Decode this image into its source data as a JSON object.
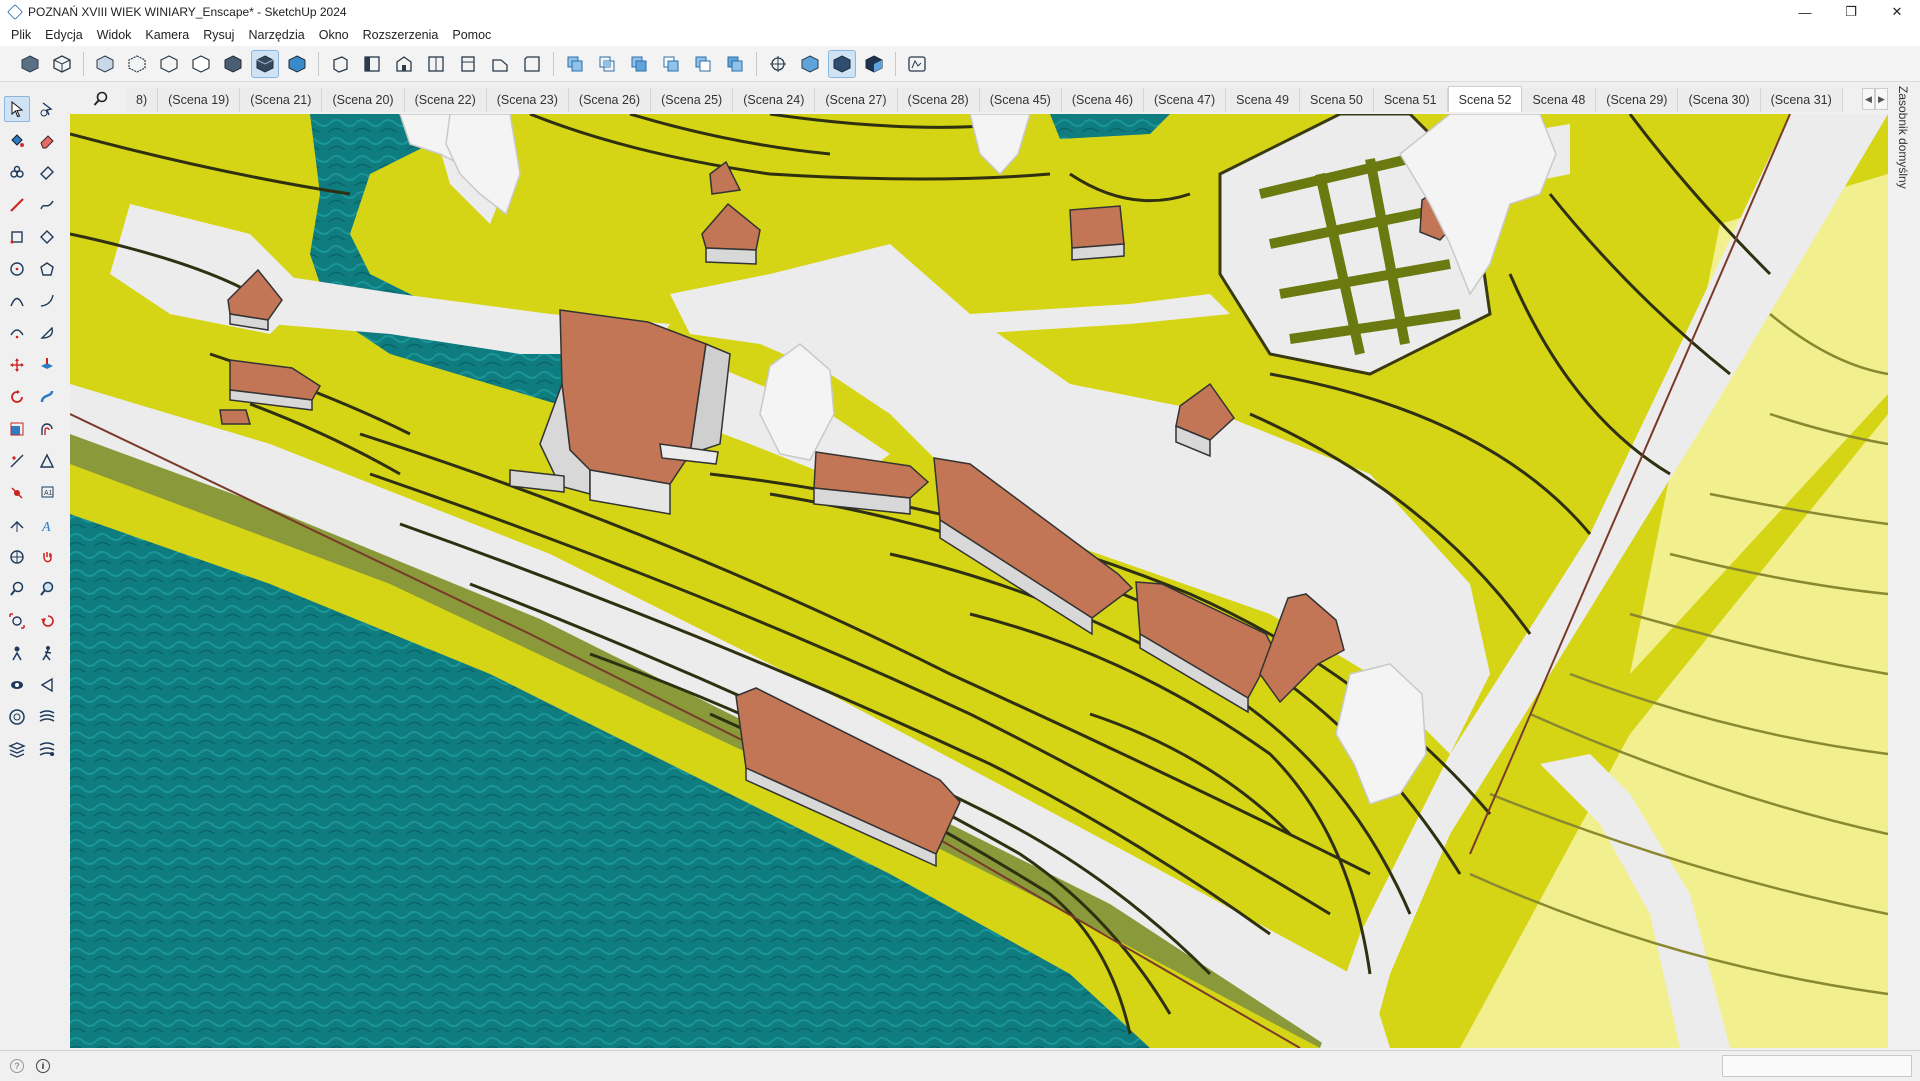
{
  "window": {
    "title": "POZNAŃ XVIII WIEK WINIARY_Enscape* - SketchUp 2024",
    "controls": {
      "minimize": "—",
      "restore": "❐",
      "close": "✕"
    }
  },
  "menu": [
    "Plik",
    "Edycja",
    "Widok",
    "Kamera",
    "Rysuj",
    "Narzędzia",
    "Okno",
    "Rozszerzenia",
    "Pomoc"
  ],
  "scene_tabs": {
    "items": [
      "8)",
      "(Scena 19)",
      "(Scena 21)",
      "(Scena 20)",
      "(Scena 22)",
      "(Scena 23)",
      "(Scena 26)",
      "(Scena 25)",
      "(Scena 24)",
      "(Scena 27)",
      "(Scena 28)",
      "(Scena 45)",
      "(Scena 46)",
      "(Scena 47)",
      "Scena 49",
      "Scena 50",
      "Scena 51",
      "Scena 52",
      "Scena 48",
      "(Scena 29)",
      "(Scena 30)",
      "(Scena 31)"
    ],
    "active": "Scena 52",
    "scroll_left": "◀",
    "scroll_right": "▶"
  },
  "right_panel": {
    "label": "Zasobnik domyślny"
  },
  "colors": {
    "terrain": "#d5d516",
    "terrain_light": "#f2ef8f",
    "water": "#0f7c80",
    "road": "#ececec",
    "roof": "#c27655",
    "contour": "#3a3a10"
  },
  "icons": {
    "top_toolbar": [
      "component-icon",
      "group-icon",
      "xray-icon",
      "back-edges-icon",
      "wireframe-icon",
      "hidden-line-icon",
      "shaded-icon",
      "shaded-textures-icon",
      "iso-view-icon",
      "top-view-icon",
      "front-view-icon",
      "right-view-icon",
      "back-view-icon",
      "left-view-icon",
      "outer-shell-icon",
      "intersect-icon",
      "union-icon",
      "subtract-icon",
      "trim-icon",
      "split-icon",
      "section-plane-icon",
      "display-sections-icon",
      "section-cuts-icon",
      "section-fill-icon",
      "model-info-icon"
    ],
    "left_toolbar": [
      "select-icon",
      "lasso-icon",
      "paint-bucket-icon",
      "eraser-icon",
      "tag-icon",
      "tape-icon",
      "line-icon",
      "freehand-icon",
      "rectangle-icon",
      "rotated-rectangle-icon",
      "circle-icon",
      "polygon-icon",
      "arc-icon",
      "two-point-arc-icon",
      "three-point-arc-icon",
      "pie-icon",
      "move-icon",
      "push-pull-icon",
      "rotate-icon",
      "follow-me-icon",
      "scale-icon",
      "offset-icon",
      "tape-measure-icon",
      "protractor-icon",
      "dimension-icon",
      "text-icon",
      "axes-icon",
      "3d-text-icon",
      "orbit-icon",
      "pan-icon",
      "zoom-icon",
      "zoom-window-icon",
      "zoom-extents-icon",
      "previous-view-icon",
      "position-camera-icon",
      "walk-icon",
      "look-around-icon",
      "section-plane-icon",
      "sandbox-icon",
      "stamp-icon",
      "drape-icon",
      "flip-icon"
    ]
  }
}
